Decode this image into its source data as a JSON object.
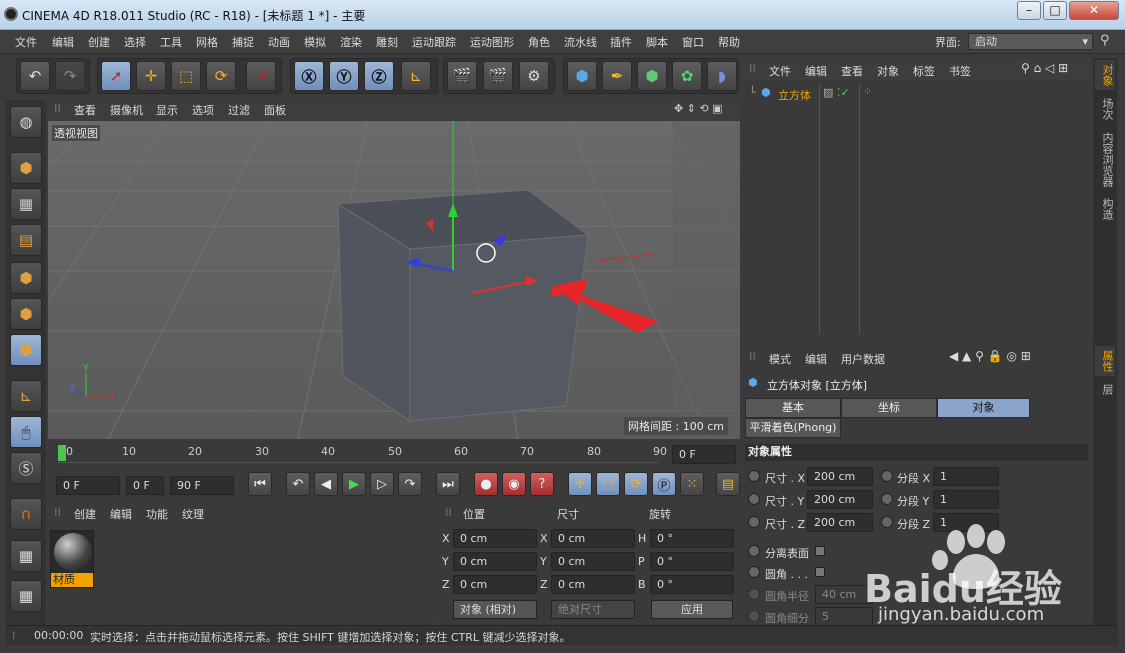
{
  "window": {
    "title": "CINEMA 4D R18.011 Studio (RC - R18) - [未标题 1 *] - 主要"
  },
  "menubar": {
    "items": [
      "文件",
      "编辑",
      "创建",
      "选择",
      "工具",
      "网格",
      "捕捉",
      "动画",
      "模拟",
      "渲染",
      "雕刻",
      "运动跟踪",
      "运动图形",
      "角色",
      "流水线",
      "插件",
      "脚本",
      "窗口",
      "帮助"
    ],
    "layout_label": "界面:",
    "layout_value": "启动"
  },
  "viewport": {
    "menu": [
      "查看",
      "摄像机",
      "显示",
      "选项",
      "过滤",
      "面板"
    ],
    "label": "透视视图",
    "grid_info": "网格间距 : 100 cm"
  },
  "timeline": {
    "ticks": [
      "0",
      "10",
      "20",
      "30",
      "40",
      "50",
      "60",
      "70",
      "80",
      "90"
    ],
    "frame_field": "0 F",
    "start": "0 F",
    "current": "0 F",
    "end": "90 F"
  },
  "materials": {
    "menu": [
      "创建",
      "编辑",
      "功能",
      "纹理"
    ],
    "item_label": "材质"
  },
  "coordinates": {
    "headers": [
      "位置",
      "尺寸",
      "旋转"
    ],
    "rows": [
      {
        "a": "X",
        "av": "0 cm",
        "b": "X",
        "bv": "0 cm",
        "c": "H",
        "cv": "0 °"
      },
      {
        "a": "Y",
        "av": "0 cm",
        "b": "Y",
        "bv": "0 cm",
        "c": "P",
        "cv": "0 °"
      },
      {
        "a": "Z",
        "av": "0 cm",
        "b": "Z",
        "bv": "0 cm",
        "c": "B",
        "cv": "0 °"
      }
    ],
    "mode1": "对象 (相对)",
    "mode2": "绝对尺寸",
    "apply": "应用"
  },
  "objects": {
    "menu": [
      "文件",
      "编辑",
      "查看",
      "对象",
      "标签",
      "书签"
    ],
    "item_name": "立方体"
  },
  "attributes": {
    "menu": [
      "模式",
      "编辑",
      "用户数据"
    ],
    "title": "立方体对象 [立方体]",
    "tabs": [
      "基本",
      "坐标",
      "对象"
    ],
    "subtab": "平滑着色(Phong)",
    "section": "对象属性",
    "size_rows": [
      {
        "label": "尺寸 . X",
        "value": "200 cm",
        "seg_label": "分段 X",
        "seg_value": "1"
      },
      {
        "label": "尺寸 . Y",
        "value": "200 cm",
        "seg_label": "分段 Y",
        "seg_value": "1"
      },
      {
        "label": "尺寸 . Z",
        "value": "200 cm",
        "seg_label": "分段 Z",
        "seg_value": "1"
      }
    ],
    "separate": "分离表面",
    "fillet": "圆角 . . .",
    "fillet_radius_label": "圆角半径",
    "fillet_radius_value": "40 cm",
    "fillet_sub_label": "圆角细分",
    "fillet_sub_value": "5"
  },
  "sidetabs": {
    "top": [
      "对象",
      "场次",
      "内容浏览器",
      "构造"
    ],
    "bottom": [
      "属性",
      "层"
    ]
  },
  "status": {
    "time": "00:00:00",
    "message": "实时选择：点击并拖动鼠标选择元素。按住 SHIFT 键增加选择对象；按住 CTRL 键减少选择对象。"
  },
  "watermark": {
    "text": "Baidu经验",
    "url": "jingyan.baidu.com"
  }
}
